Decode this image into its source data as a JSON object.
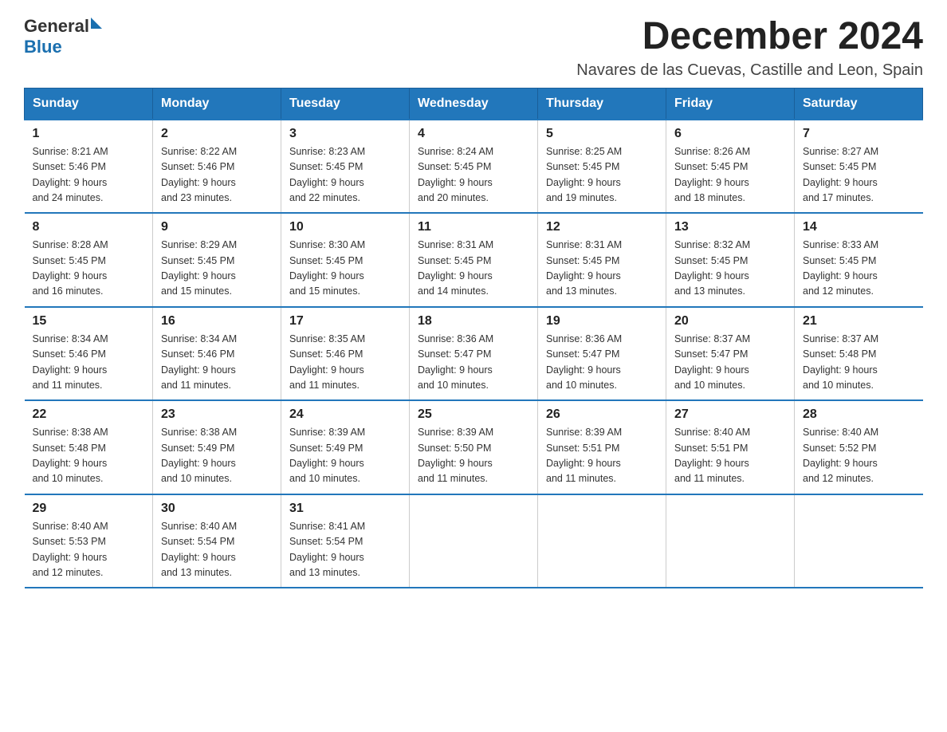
{
  "logo": {
    "general": "General",
    "blue": "Blue"
  },
  "title": "December 2024",
  "subtitle": "Navares de las Cuevas, Castille and Leon, Spain",
  "weekdays": [
    "Sunday",
    "Monday",
    "Tuesday",
    "Wednesday",
    "Thursday",
    "Friday",
    "Saturday"
  ],
  "weeks": [
    [
      {
        "day": "1",
        "sunrise": "8:21 AM",
        "sunset": "5:46 PM",
        "daylight": "9 hours and 24 minutes."
      },
      {
        "day": "2",
        "sunrise": "8:22 AM",
        "sunset": "5:46 PM",
        "daylight": "9 hours and 23 minutes."
      },
      {
        "day": "3",
        "sunrise": "8:23 AM",
        "sunset": "5:45 PM",
        "daylight": "9 hours and 22 minutes."
      },
      {
        "day": "4",
        "sunrise": "8:24 AM",
        "sunset": "5:45 PM",
        "daylight": "9 hours and 20 minutes."
      },
      {
        "day": "5",
        "sunrise": "8:25 AM",
        "sunset": "5:45 PM",
        "daylight": "9 hours and 19 minutes."
      },
      {
        "day": "6",
        "sunrise": "8:26 AM",
        "sunset": "5:45 PM",
        "daylight": "9 hours and 18 minutes."
      },
      {
        "day": "7",
        "sunrise": "8:27 AM",
        "sunset": "5:45 PM",
        "daylight": "9 hours and 17 minutes."
      }
    ],
    [
      {
        "day": "8",
        "sunrise": "8:28 AM",
        "sunset": "5:45 PM",
        "daylight": "9 hours and 16 minutes."
      },
      {
        "day": "9",
        "sunrise": "8:29 AM",
        "sunset": "5:45 PM",
        "daylight": "9 hours and 15 minutes."
      },
      {
        "day": "10",
        "sunrise": "8:30 AM",
        "sunset": "5:45 PM",
        "daylight": "9 hours and 15 minutes."
      },
      {
        "day": "11",
        "sunrise": "8:31 AM",
        "sunset": "5:45 PM",
        "daylight": "9 hours and 14 minutes."
      },
      {
        "day": "12",
        "sunrise": "8:31 AM",
        "sunset": "5:45 PM",
        "daylight": "9 hours and 13 minutes."
      },
      {
        "day": "13",
        "sunrise": "8:32 AM",
        "sunset": "5:45 PM",
        "daylight": "9 hours and 13 minutes."
      },
      {
        "day": "14",
        "sunrise": "8:33 AM",
        "sunset": "5:45 PM",
        "daylight": "9 hours and 12 minutes."
      }
    ],
    [
      {
        "day": "15",
        "sunrise": "8:34 AM",
        "sunset": "5:46 PM",
        "daylight": "9 hours and 11 minutes."
      },
      {
        "day": "16",
        "sunrise": "8:34 AM",
        "sunset": "5:46 PM",
        "daylight": "9 hours and 11 minutes."
      },
      {
        "day": "17",
        "sunrise": "8:35 AM",
        "sunset": "5:46 PM",
        "daylight": "9 hours and 11 minutes."
      },
      {
        "day": "18",
        "sunrise": "8:36 AM",
        "sunset": "5:47 PM",
        "daylight": "9 hours and 10 minutes."
      },
      {
        "day": "19",
        "sunrise": "8:36 AM",
        "sunset": "5:47 PM",
        "daylight": "9 hours and 10 minutes."
      },
      {
        "day": "20",
        "sunrise": "8:37 AM",
        "sunset": "5:47 PM",
        "daylight": "9 hours and 10 minutes."
      },
      {
        "day": "21",
        "sunrise": "8:37 AM",
        "sunset": "5:48 PM",
        "daylight": "9 hours and 10 minutes."
      }
    ],
    [
      {
        "day": "22",
        "sunrise": "8:38 AM",
        "sunset": "5:48 PM",
        "daylight": "9 hours and 10 minutes."
      },
      {
        "day": "23",
        "sunrise": "8:38 AM",
        "sunset": "5:49 PM",
        "daylight": "9 hours and 10 minutes."
      },
      {
        "day": "24",
        "sunrise": "8:39 AM",
        "sunset": "5:49 PM",
        "daylight": "9 hours and 10 minutes."
      },
      {
        "day": "25",
        "sunrise": "8:39 AM",
        "sunset": "5:50 PM",
        "daylight": "9 hours and 11 minutes."
      },
      {
        "day": "26",
        "sunrise": "8:39 AM",
        "sunset": "5:51 PM",
        "daylight": "9 hours and 11 minutes."
      },
      {
        "day": "27",
        "sunrise": "8:40 AM",
        "sunset": "5:51 PM",
        "daylight": "9 hours and 11 minutes."
      },
      {
        "day": "28",
        "sunrise": "8:40 AM",
        "sunset": "5:52 PM",
        "daylight": "9 hours and 12 minutes."
      }
    ],
    [
      {
        "day": "29",
        "sunrise": "8:40 AM",
        "sunset": "5:53 PM",
        "daylight": "9 hours and 12 minutes."
      },
      {
        "day": "30",
        "sunrise": "8:40 AM",
        "sunset": "5:54 PM",
        "daylight": "9 hours and 13 minutes."
      },
      {
        "day": "31",
        "sunrise": "8:41 AM",
        "sunset": "5:54 PM",
        "daylight": "9 hours and 13 minutes."
      },
      null,
      null,
      null,
      null
    ]
  ],
  "labels": {
    "sunrise": "Sunrise:",
    "sunset": "Sunset:",
    "daylight": "Daylight:"
  }
}
